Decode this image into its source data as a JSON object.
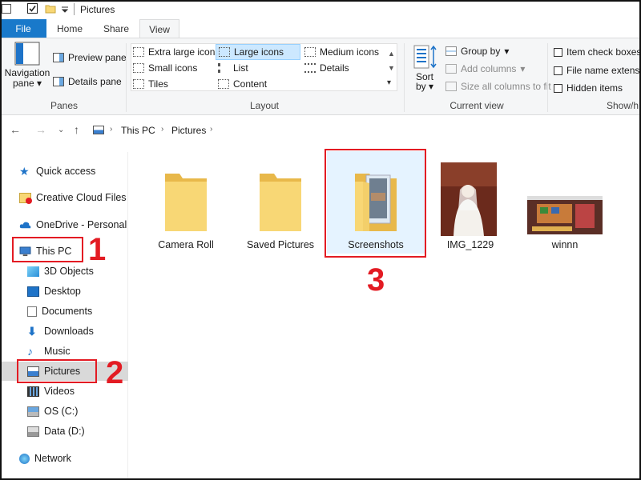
{
  "window": {
    "title": "Pictures"
  },
  "tabs": [
    {
      "label": "File"
    },
    {
      "label": "Home"
    },
    {
      "label": "Share"
    },
    {
      "label": "View"
    }
  ],
  "ribbon": {
    "panes": {
      "nav_pane_line1": "Navigation",
      "nav_pane_line2": "pane",
      "preview_pane": "Preview pane",
      "details_pane": "Details pane",
      "label": "Panes"
    },
    "layout": {
      "extra_large": "Extra large icons",
      "large": "Large icons",
      "medium": "Medium icons",
      "small": "Small icons",
      "list": "List",
      "details": "Details",
      "tiles": "Tiles",
      "content": "Content",
      "label": "Layout"
    },
    "current_view": {
      "sort_line1": "Sort",
      "sort_line2": "by",
      "group_by": "Group by",
      "add_columns": "Add columns",
      "size_all": "Size all columns to fit",
      "label": "Current view"
    },
    "show_hide": {
      "item_check_boxes": "Item check boxes",
      "file_name_ext": "File name extensio",
      "hidden_items": "Hidden items",
      "label": "Show/h"
    }
  },
  "address": {
    "this_pc": "This PC",
    "pictures": "Pictures"
  },
  "nav": {
    "quick_access": "Quick access",
    "creative_cloud": "Creative Cloud Files",
    "onedrive": "OneDrive - Personal",
    "this_pc": "This PC",
    "objects3d": "3D Objects",
    "desktop": "Desktop",
    "documents": "Documents",
    "downloads": "Downloads",
    "music": "Music",
    "pictures": "Pictures",
    "videos": "Videos",
    "os_c": "OS (C:)",
    "data_d": "Data (D:)",
    "network": "Network"
  },
  "files": [
    {
      "name": "Camera Roll"
    },
    {
      "name": "Saved Pictures"
    },
    {
      "name": "Screenshots"
    },
    {
      "name": "IMG_1229"
    },
    {
      "name": "winnn"
    }
  ],
  "annotations": {
    "one": "1",
    "two": "2",
    "three": "3"
  },
  "colors": {
    "file_tab": "#1979ca",
    "annotation": "#e31b23",
    "folder": "#f8d775",
    "selection": "#cce8ff"
  }
}
